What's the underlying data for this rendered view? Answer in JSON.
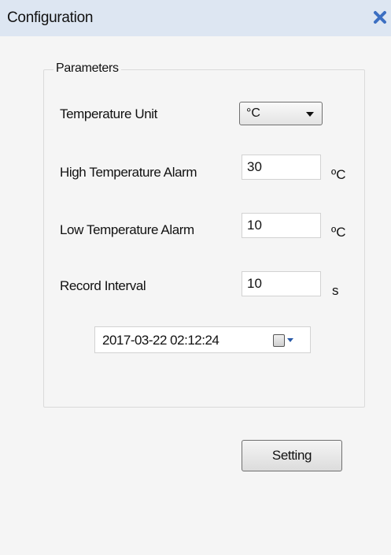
{
  "window": {
    "title": "Configuration",
    "close_icon": "close-icon",
    "accent_color": "#3c6fc2"
  },
  "group": {
    "label": "Parameters"
  },
  "temperature_unit": {
    "label": "Temperature Unit",
    "selected": "°C"
  },
  "high_alarm": {
    "label": "High Temperature Alarm",
    "value": "30",
    "unit": "ºC"
  },
  "low_alarm": {
    "label": "Low Temperature Alarm",
    "value": "10",
    "unit": "ºC"
  },
  "record_interval": {
    "label": "Record Interval",
    "value": "10",
    "unit": "s"
  },
  "datetime": {
    "value": "2017-03-22 02:12:24",
    "calendar_icon": "calendar-icon"
  },
  "setting_button": {
    "label": "Setting"
  }
}
